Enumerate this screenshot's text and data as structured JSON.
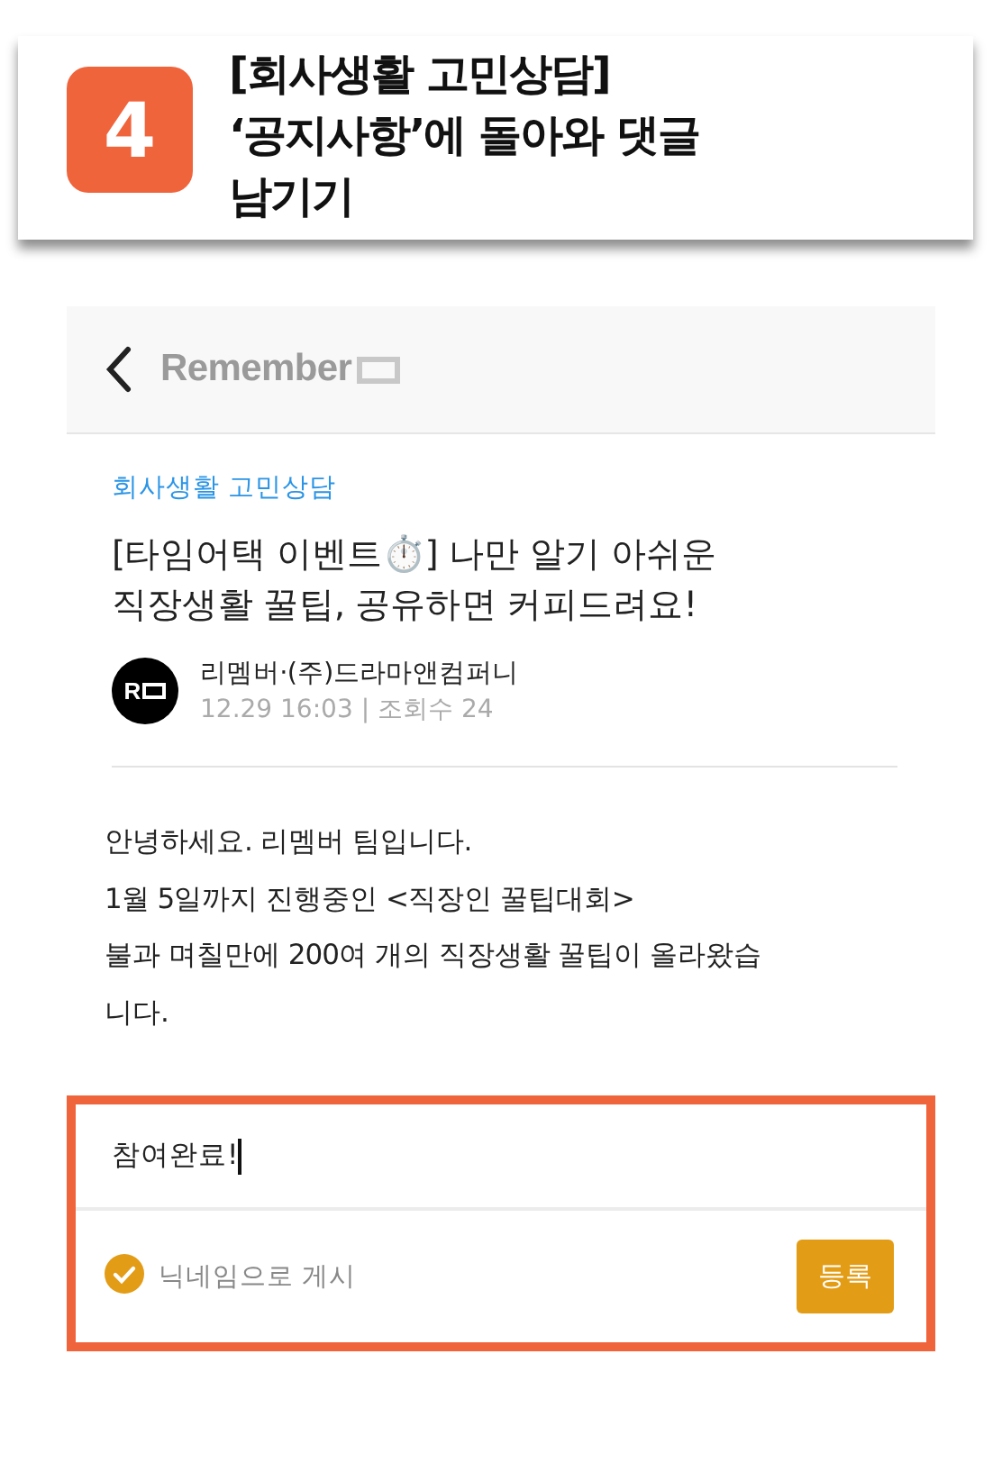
{
  "step": {
    "number": "4",
    "title_lines": [
      "[회사생활 고민상담]",
      "‘공지사항’에 돌아와 댓글",
      "남기기"
    ]
  },
  "app_header": {
    "logo": "Remember"
  },
  "post": {
    "category": "회사생활 고민상담",
    "title_lines": [
      "[타임어택 이벤트⏱️] 나만 알기 아쉬운",
      "직장생활 꿀팁, 공유하면 커피드려요!"
    ],
    "avatar_text": "R",
    "author": "리멤버·(주)드라마앤컴퍼니",
    "meta": "12.29 16:03 | 조회수 24",
    "body_lines": [
      "안녕하세요. 리멤버 팀입니다.",
      "1월 5일까지 진행중인 <직장인 꿀팁대회>",
      "불과 며칠만에 200여 개의 직장생활 꿀팁이 올라왔습",
      "니다."
    ]
  },
  "comment": {
    "value": "참여완료!",
    "nickname_option": {
      "label": "닉네임으로 게시",
      "checked": true
    },
    "submit": "등록"
  }
}
